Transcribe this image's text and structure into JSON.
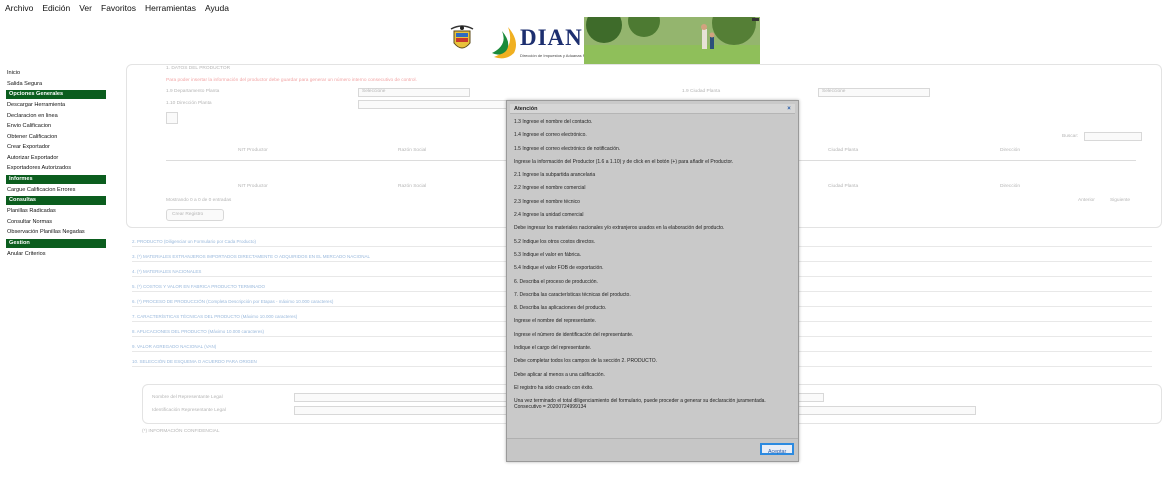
{
  "menubar": [
    "Archivo",
    "Edición",
    "Ver",
    "Favoritos",
    "Herramientas",
    "Ayuda"
  ],
  "banner": {
    "brand": "DIAN",
    "subtitle": "Dirección de Impuestos y Aduanas Nacionales"
  },
  "sidebar": {
    "items_top": [
      "Inicio",
      "Salida Segura"
    ],
    "groups": [
      {
        "heading": "Opciones Generales",
        "items": [
          "Descargar Herramienta",
          "Declaracion en linea",
          "Envio Calificacion",
          "Obtener Calificacion",
          "Crear Exportador",
          "Autorizar Exportador",
          "Exportadores Autorizados"
        ]
      },
      {
        "heading": "Informes",
        "items": [
          "Cargue Calificacion Errores"
        ]
      },
      {
        "heading": "Consultas",
        "items": [
          "Planillas Radicadas",
          "Consultar Normas",
          "Observación Planillas Negadas"
        ]
      },
      {
        "heading": "Gestion",
        "items": [
          "Anular Criterios"
        ]
      }
    ]
  },
  "form": {
    "top_label": "1. DATOS DEL PRODUCTOR",
    "warning": "Para poder insertar la información del productor debe guardar para generar un número interno consecutivo de control.",
    "dept_label": "1.9 Departamento Planta",
    "dept_select": "Seleccione",
    "dir_label": "1.10 Dirección Planta",
    "city_label": "1.9 Ciudad Planta",
    "city_select": "Seleccione",
    "search_label": "Buscar:",
    "col_nit": "NIT Productor",
    "col_razon": "Razón Social",
    "col_ciudad": "Ciudad Planta",
    "col_direccion": "Dirección",
    "showing": "Mostrando 0 a 0 de 0 entradas",
    "prev": "Anterior",
    "next": "Siguiente",
    "create_btn": "Crear Registro",
    "sections": [
      "2. PRODUCTO (Diligenciar un Formulario por Cada Producto)",
      "3. (*) MATERIALES EXTRANJEROS IMPORTADOS DIRECTAMENTE O ADQUIRIDOS EN EL MERCADO NACIONAL",
      "4. (*) MATERIALES NACIONALES",
      "5. (*) COSTOS Y VALOR EN FABRICA PRODUCTO TERMINADO",
      "6. (*) PROCESO DE PRODUCCIÓN (Completa Descripción por Etapas - máximo 10.000 caracteres)",
      "7. CARACTERÍSTICAS TÉCNICAS DEL PRODUCTO (Máximo 10.000 caracteres)",
      "8. APLICACIONES DEL PRODUCTO (Máximo 10.000 caracteres)",
      "9. VALOR AGREGADO NACIONAL (VAN)",
      "10. SELECCIÓN DE ESQUEMA O ACUERDO PARA ORIGEN"
    ],
    "rep_name": "Nombre del Representante Legal",
    "rep_id": "Identificación Representante Legal",
    "confidential": "(*) INFORMACIÓN CONFIDENCIAL"
  },
  "modal": {
    "title": "Atención",
    "close": "×",
    "messages": [
      "1.3 Ingrese el nombre del contacto.",
      "1.4 Ingrese el correo electrónico.",
      "1.5 Ingrese el correo electrónico de notificación.",
      "Ingrese la información del Productor (1.6 a 1.10) y de click en el botón (+) para añadir el Productor.",
      "2.1 Ingrese la subpartida arancelaria",
      "2.2 Ingrese el nombre comercial",
      "2.3 Ingrese el nombre técnico",
      "2.4 Ingrese la unidad comercial",
      "Debe ingresar los materiales nacionales y/o extranjeros usados en la elaboración del producto.",
      "5.2 Indique los otros costos directos.",
      "5.3 Indique el valor en fábrica.",
      "5.4 Indique el valor FOB de exportación.",
      "6. Describa el proceso de producción.",
      "7. Describa las características técnicas del producto.",
      "8. Describa las aplicaciones del producto.",
      "Ingrese el nombre del representante.",
      "Ingrese el número de identificación del representante.",
      "Indique el cargo del representante.",
      "Debe completar todos los campos de la sección 2. PRODUCTO.",
      "Debe aplicar al menos a una calificación.",
      "El registro ha sido creado con éxito."
    ],
    "final_message": "Una vez terminado el total diligenciamiento del formulario, puede proceder a generar su declaración juramentada.",
    "consecutivo": "Consecutivo = 20200724999134",
    "accept": "Aceptar"
  }
}
